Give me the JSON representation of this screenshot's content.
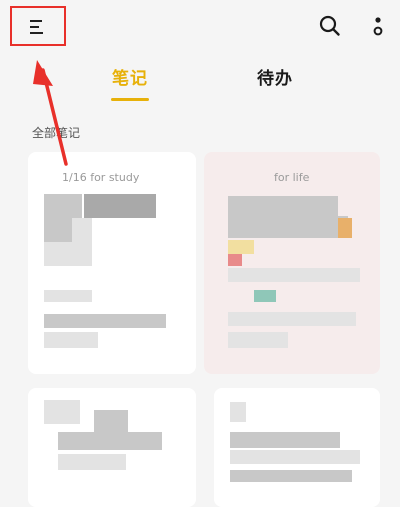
{
  "header": {
    "menu_icon": "menu-icon",
    "search_icon": "search-icon",
    "more_icon": "more-vertical-icon"
  },
  "tabs": [
    {
      "label": "笔记",
      "active": true
    },
    {
      "label": "待办",
      "active": false
    }
  ],
  "section": {
    "title": "全部笔记"
  },
  "notes": [
    {
      "tag": "1/16   for study"
    },
    {
      "tag": "for life"
    }
  ],
  "colors": {
    "accent": "#e7b10a",
    "annotation": "#e8302a"
  }
}
